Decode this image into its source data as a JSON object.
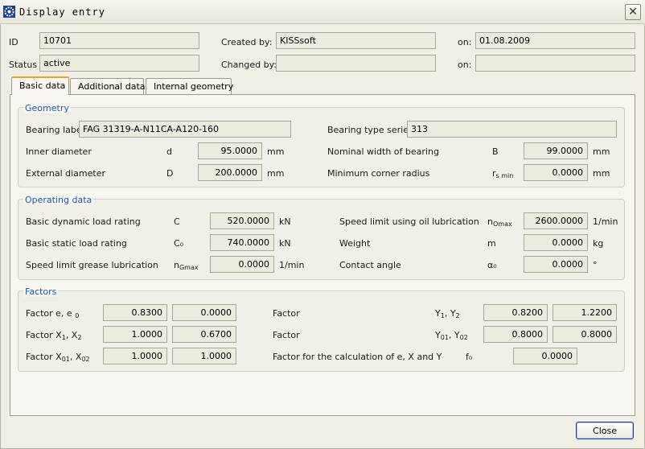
{
  "window": {
    "title": "Display entry"
  },
  "header": {
    "id_label": "ID",
    "id_value": "10701",
    "status_label": "Status",
    "status_value": "active",
    "created_by_label": "Created by:",
    "created_by_value": "KISSsoft",
    "created_on_label": "on:",
    "created_on_value": "01.08.2009",
    "changed_by_label": "Changed by:",
    "changed_by_value": "",
    "changed_on_label": "on:",
    "changed_on_value": ""
  },
  "tabs": [
    {
      "label": "Basic data",
      "active": true
    },
    {
      "label": "Additional data",
      "active": false
    },
    {
      "label": "Internal geometry",
      "active": false
    }
  ],
  "geometry": {
    "title": "Geometry",
    "bearing_label_label": "Bearing label",
    "bearing_label_value": "FAG 31319-A-N11CA-A120-160",
    "bearing_type_series_label": "Bearing type series",
    "bearing_type_series_value": "313",
    "inner_diameter_label": "Inner diameter",
    "inner_diameter_symbol": "d",
    "inner_diameter_value": "95.0000",
    "inner_diameter_unit": "mm",
    "external_diameter_label": "External diameter",
    "external_diameter_symbol": "D",
    "external_diameter_value": "200.0000",
    "external_diameter_unit": "mm",
    "nominal_width_label": "Nominal width of bearing",
    "nominal_width_symbol": "B",
    "nominal_width_value": "99.0000",
    "nominal_width_unit": "mm",
    "min_corner_radius_label": "Minimum corner radius",
    "min_corner_radius_symbol": "r",
    "min_corner_radius_symbol_sub": "s min",
    "min_corner_radius_value": "0.0000",
    "min_corner_radius_unit": "mm"
  },
  "operating": {
    "title": "Operating data",
    "dyn_load_label": "Basic dynamic load rating",
    "dyn_load_symbol": "C",
    "dyn_load_value": "520.0000",
    "dyn_load_unit": "kN",
    "static_load_label": "Basic static load rating",
    "static_load_symbol": "C₀",
    "static_load_value": "740.0000",
    "static_load_unit": "kN",
    "grease_speed_label": "Speed limit grease lubrication",
    "grease_speed_symbol": "n",
    "grease_speed_symbol_sub": "Gmax",
    "grease_speed_value": "0.0000",
    "grease_speed_unit": "1/min",
    "oil_speed_label": "Speed limit using oil lubrication",
    "oil_speed_symbol": "n",
    "oil_speed_symbol_sub": "Omax",
    "oil_speed_value": "2600.0000",
    "oil_speed_unit": "1/min",
    "weight_label": "Weight",
    "weight_symbol": "m",
    "weight_value": "0.0000",
    "weight_unit": "kg",
    "contact_angle_label": "Contact angle",
    "contact_angle_symbol": "α₀",
    "contact_angle_value": "0.0000",
    "contact_angle_unit": "°"
  },
  "factors": {
    "title": "Factors",
    "e_label": "Factor  e, e",
    "e_label_sub": "0",
    "e_value1": "0.8300",
    "e_value2": "0.0000",
    "x_label": "Factor  X",
    "x_label_rest": ", X",
    "x_value1": "1.0000",
    "x_value2": "0.6700",
    "x0_label": "Factor  X",
    "x0_label_rest": ", X",
    "x0_value1": "1.0000",
    "x0_value2": "1.0000",
    "y_label": "Factor",
    "y_symbol": "Y",
    "y_symbol_rest": ", Y",
    "y_value1": "0.8200",
    "y_value2": "1.2200",
    "y0_label": "Factor",
    "y0_symbol": "Y",
    "y0_symbol_rest": ", Y",
    "y0_value1": "0.8000",
    "y0_value2": "0.8000",
    "f0_label": "Factor for the calculation of e, X and Y",
    "f0_symbol": "f₀",
    "f0_value": "0.0000"
  },
  "footer": {
    "close_label": "Close"
  }
}
